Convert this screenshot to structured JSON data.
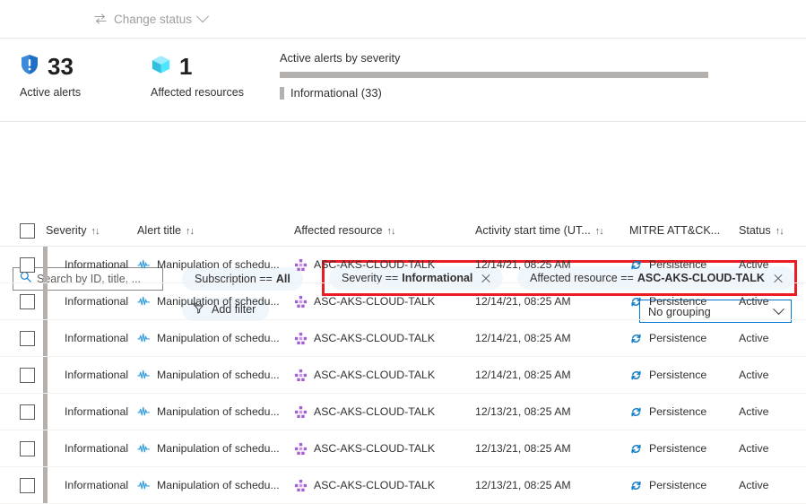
{
  "toolbar": {
    "change_status_label": "Change status",
    "swap_icon": "swap-arrows-icon",
    "chevron_icon": "chevron-down-icon"
  },
  "summary": {
    "active_alerts": {
      "count": "33",
      "label": "Active alerts",
      "icon": "shield-alert-icon"
    },
    "affected_resources": {
      "count": "1",
      "label": "Affected resources",
      "icon": "cube-icon"
    },
    "severity_chart": {
      "title": "Active alerts by severity",
      "legend_label": "Informational (33)",
      "bar_color": "#b3b0ad"
    }
  },
  "filters": {
    "search_placeholder": "Search by ID, title, ...",
    "search_value": "",
    "search_icon": "search-icon",
    "subscription": {
      "field": "Subscription ==",
      "value": "All"
    },
    "add_filter": {
      "label": "Add filter",
      "icon": "add-filter-icon"
    },
    "severity": {
      "field": "Severity ==",
      "value": "Informational",
      "close_icon": "close-icon"
    },
    "affected_resource": {
      "field": "Affected resource ==",
      "value": "ASC-AKS-CLOUD-TALK",
      "close_icon": "close-icon"
    },
    "highlight_color": "#ec1c24",
    "grouping": {
      "selected": "No grouping",
      "chevron_icon": "chevron-down-icon"
    }
  },
  "table": {
    "columns": [
      {
        "key": "severity",
        "label": "Severity",
        "sortable": true
      },
      {
        "key": "title",
        "label": "Alert title",
        "sortable": true
      },
      {
        "key": "resource",
        "label": "Affected resource",
        "sortable": true
      },
      {
        "key": "time",
        "label": "Activity start time (UT...",
        "sortable": true
      },
      {
        "key": "mitre",
        "label": "MITRE ATT&CK...",
        "sortable": false
      },
      {
        "key": "status",
        "label": "Status",
        "sortable": true
      }
    ],
    "sort_icon": "sort-arrows-icon",
    "select_all_checkbox": "unchecked",
    "rows": [
      {
        "severity": "Informational",
        "title": "Manipulation of schedu...",
        "title_icon": "alert-waveform-icon",
        "resource": "ASC-AKS-CLOUD-TALK",
        "resource_icon": "kubernetes-cluster-icon",
        "time": "12/14/21, 08:25 AM",
        "mitre": "Persistence",
        "mitre_icon": "persistence-cycle-icon",
        "status": "Active"
      },
      {
        "severity": "Informational",
        "title": "Manipulation of schedu...",
        "title_icon": "alert-waveform-icon",
        "resource": "ASC-AKS-CLOUD-TALK",
        "resource_icon": "kubernetes-cluster-icon",
        "time": "12/14/21, 08:25 AM",
        "mitre": "Persistence",
        "mitre_icon": "persistence-cycle-icon",
        "status": "Active"
      },
      {
        "severity": "Informational",
        "title": "Manipulation of schedu...",
        "title_icon": "alert-waveform-icon",
        "resource": "ASC-AKS-CLOUD-TALK",
        "resource_icon": "kubernetes-cluster-icon",
        "time": "12/14/21, 08:25 AM",
        "mitre": "Persistence",
        "mitre_icon": "persistence-cycle-icon",
        "status": "Active"
      },
      {
        "severity": "Informational",
        "title": "Manipulation of schedu...",
        "title_icon": "alert-waveform-icon",
        "resource": "ASC-AKS-CLOUD-TALK",
        "resource_icon": "kubernetes-cluster-icon",
        "time": "12/14/21, 08:25 AM",
        "mitre": "Persistence",
        "mitre_icon": "persistence-cycle-icon",
        "status": "Active"
      },
      {
        "severity": "Informational",
        "title": "Manipulation of schedu...",
        "title_icon": "alert-waveform-icon",
        "resource": "ASC-AKS-CLOUD-TALK",
        "resource_icon": "kubernetes-cluster-icon",
        "time": "12/13/21, 08:25 AM",
        "mitre": "Persistence",
        "mitre_icon": "persistence-cycle-icon",
        "status": "Active"
      },
      {
        "severity": "Informational",
        "title": "Manipulation of schedu...",
        "title_icon": "alert-waveform-icon",
        "resource": "ASC-AKS-CLOUD-TALK",
        "resource_icon": "kubernetes-cluster-icon",
        "time": "12/13/21, 08:25 AM",
        "mitre": "Persistence",
        "mitre_icon": "persistence-cycle-icon",
        "status": "Active"
      },
      {
        "severity": "Informational",
        "title": "Manipulation of schedu...",
        "title_icon": "alert-waveform-icon",
        "resource": "ASC-AKS-CLOUD-TALK",
        "resource_icon": "kubernetes-cluster-icon",
        "time": "12/13/21, 08:25 AM",
        "mitre": "Persistence",
        "mitre_icon": "persistence-cycle-icon",
        "status": "Active"
      }
    ]
  }
}
